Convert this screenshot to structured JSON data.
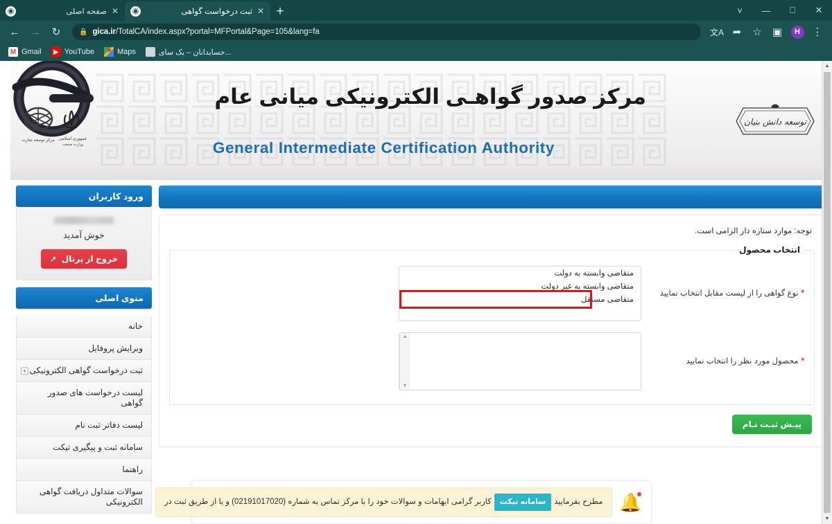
{
  "browser": {
    "tabs": [
      {
        "title": "ثبت درخواست گواهی",
        "active": true
      },
      {
        "title": "صفحه اصلی",
        "active": false
      }
    ],
    "new_tab_label": "+",
    "window_controls": {
      "tab_search": "tab-search-icon",
      "minimize": "minimize-icon",
      "maximize": "maximize-icon",
      "close": "close-icon"
    },
    "nav": {
      "back": "back-arrow-icon",
      "forward": "forward-arrow-icon",
      "reload": "reload-icon"
    },
    "omnibox": {
      "lock": "lock-icon",
      "url_host": "gica.ir",
      "url_path": "/TotalCA/index.aspx?portal=MFPortal&Page=105&lang=fa"
    },
    "toolbar_right": [
      "translate-icon",
      "share-icon",
      "bookmark-star-icon",
      "side-panel-icon",
      "profile-avatar",
      "more-menu-icon"
    ],
    "profile_initial": "H",
    "bookmarks": [
      {
        "label": "Gmail",
        "icon": "gmail-icon"
      },
      {
        "label": "YouTube",
        "icon": "youtube-icon"
      },
      {
        "label": "Maps",
        "icon": "maps-icon"
      },
      {
        "label": "حسابدانان – یک سای...",
        "icon": "site-icon"
      }
    ]
  },
  "site": {
    "brand_fa": "مرکز صدور گواهـی الکترونیکی میانی عام",
    "brand_en": "General Intermediate Certification Authority",
    "logo_name": "gica-logo",
    "right_seal_name": "knowledge-based-seal",
    "left_seal_name": "ministry-seals"
  },
  "sidebar": {
    "login_panel_title": "ورود کاربران",
    "welcome_text": "خوش آمدید",
    "logout_label": "خروج از پرتال",
    "menu_panel_title": "منوی اصلی",
    "menu_items": [
      {
        "label": "خانه",
        "expandable": false
      },
      {
        "label": "ویرایش پروفایل",
        "expandable": false
      },
      {
        "label": "ثبت درخواست گواهی الکترونیکی",
        "expandable": true,
        "expander": "+"
      },
      {
        "label": "لیست درخواست های صدور گواهی",
        "expandable": false
      },
      {
        "label": "لیست دفاتر ثبت نام",
        "expandable": false
      },
      {
        "label": "سامانه ثبت و پیگیری تیکت",
        "expandable": false
      },
      {
        "label": "راهنما",
        "expandable": false
      },
      {
        "label": "سوالات متداول دریافت گواهی الکترونیکی",
        "expandable": false
      }
    ]
  },
  "main": {
    "note": "توجه: موارد ستاره دار الزامی است.",
    "fieldset_legend": "انتخاب محصول",
    "field_cert_type": {
      "label": "نوع گواهی را از لیست مقابل انتخاب نمایید",
      "required_mark": "*",
      "options": [
        "متقاضی وابسته به دولت",
        "متقاضی وابسته به غیر دولت",
        "متقاضی مستقل"
      ],
      "highlighted_option_index": 2
    },
    "field_product": {
      "label": "محصول مورد نظر را انتخاب نمایید",
      "required_mark": "*",
      "options": []
    },
    "submit_label": "پیـش ثبـت نـام"
  },
  "notification": {
    "icon": "bell-icon",
    "text_before": "کاربر گرامی ابهامات و سوالات خود را با مرکز تماس به شماره (02191017020) و یا از طریق ثبت در",
    "chip_label": "سامانه تیکت",
    "text_after": "مطرح بفرمایید"
  },
  "colors": {
    "browser_chrome": "#1d5252",
    "panel_blue": "#1274c0",
    "logout_red": "#da333d",
    "submit_green": "#2faa47",
    "highlight_red": "#e11313",
    "ticket_teal": "#2cb5c7",
    "notify_bg": "#fbf3d5",
    "brand_blue": "#1b6eb3"
  }
}
